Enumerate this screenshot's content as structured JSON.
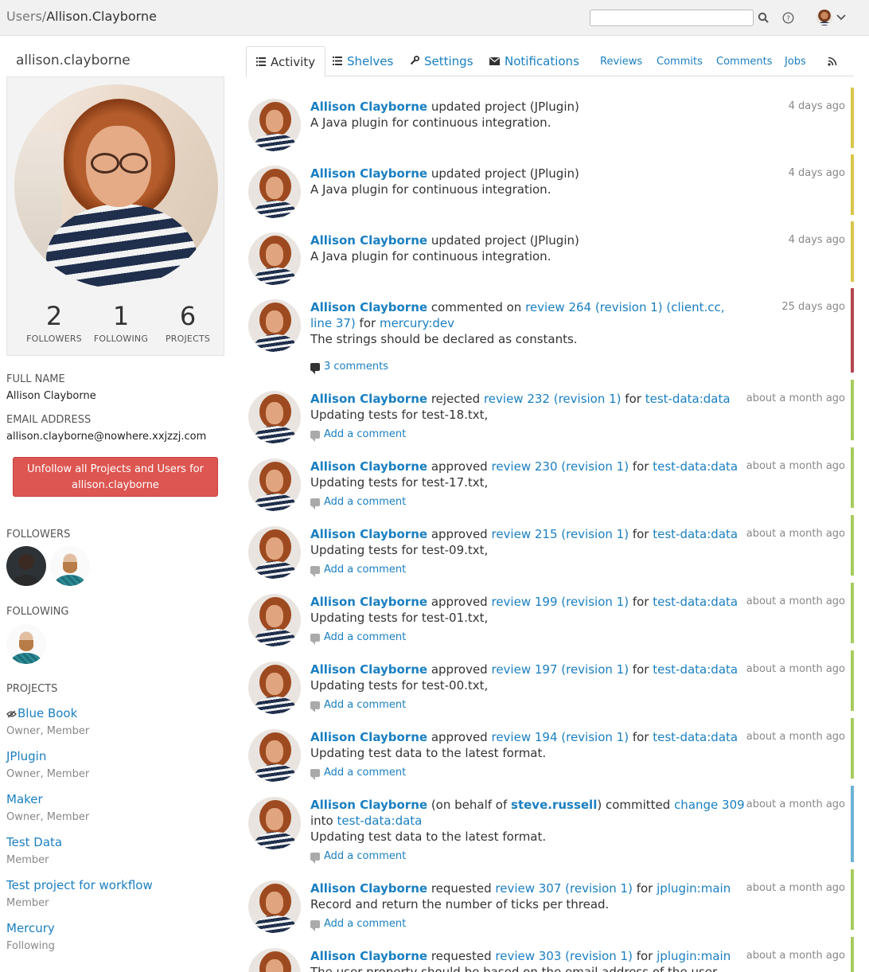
{
  "breadcrumb": {
    "root": "Users/",
    "current": "Allison.Clayborne"
  },
  "search": {
    "placeholder": ""
  },
  "profile": {
    "username": "allison.clayborne",
    "stats": [
      {
        "value": "2",
        "label": "FOLLOWERS"
      },
      {
        "value": "1",
        "label": "FOLLOWING"
      },
      {
        "value": "6",
        "label": "PROJECTS"
      }
    ],
    "full_name_label": "FULL NAME",
    "full_name": "Allison Clayborne",
    "email_label": "EMAIL ADDRESS",
    "email": "allison.clayborne@nowhere.xxjzzj.com",
    "unfollow_line1": "Unfollow all Projects and Users for",
    "unfollow_line2": "allison.clayborne",
    "followers_label": "FOLLOWERS",
    "following_label": "FOLLOWING",
    "projects_label": "PROJECTS",
    "projects": [
      {
        "name": "Blue Book",
        "role": "Owner, Member"
      },
      {
        "name": "JPlugin",
        "role": "Owner, Member"
      },
      {
        "name": "Maker",
        "role": "Owner, Member"
      },
      {
        "name": "Test Data",
        "role": "Member"
      },
      {
        "name": "Test project for workflow",
        "role": "Member"
      },
      {
        "name": "Mercury",
        "role": "Following"
      }
    ]
  },
  "tabs": {
    "activity": "Activity",
    "shelves": "Shelves",
    "settings": "Settings",
    "notifications": "Notifications",
    "reviews": "Reviews",
    "commits": "Commits",
    "comments": "Comments",
    "jobs": "Jobs"
  },
  "colors": {
    "link": "#1a7fc1",
    "yellow": "#d8c64a",
    "red": "#b5454f",
    "green": "#a6cc5e",
    "blue": "#6db3d6",
    "unfollow": "#dd5651"
  },
  "feed": [
    {
      "actor": "Allison Clayborne",
      "verb": " updated project (JPlugin)",
      "desc": "A Java plugin for continuous integration.",
      "time": "4 days ago"
    },
    {
      "actor": "Allison Clayborne",
      "verb": " updated project (JPlugin)",
      "desc": "A Java plugin for continuous integration.",
      "time": "4 days ago"
    },
    {
      "actor": "Allison Clayborne",
      "verb": " updated project (JPlugin)",
      "desc": "A Java plugin for continuous integration.",
      "time": "4 days ago"
    },
    {
      "actor": "Allison Clayborne",
      "verb": " commented on ",
      "link": "review 264 (revision 1) (client.cc, line 37)",
      "for": " for ",
      "target": "mercury:dev",
      "desc": "The strings should be declared as constants.",
      "time": "25 days ago",
      "comment": "3 comments"
    },
    {
      "actor": "Allison Clayborne",
      "verb": " rejected ",
      "link": "review 232 (revision 1)",
      "for": " for ",
      "target": "test-data:data",
      "desc": "Updating tests for test-18.txt,",
      "time": "about a month ago",
      "comment": "Add a comment"
    },
    {
      "actor": "Allison Clayborne",
      "verb": " approved ",
      "link": "review 230 (revision 1)",
      "for": " for ",
      "target": "test-data:data",
      "desc": "Updating tests for test-17.txt,",
      "time": "about a month ago",
      "comment": "Add a comment"
    },
    {
      "actor": "Allison Clayborne",
      "verb": " approved ",
      "link": "review 215 (revision 1)",
      "for": " for ",
      "target": "test-data:data",
      "desc": "Updating tests for test-09.txt,",
      "time": "about a month ago",
      "comment": "Add a comment"
    },
    {
      "actor": "Allison Clayborne",
      "verb": " approved ",
      "link": "review 199 (revision 1)",
      "for": " for ",
      "target": "test-data:data",
      "desc": "Updating tests for test-01.txt,",
      "time": "about a month ago",
      "comment": "Add a comment"
    },
    {
      "actor": "Allison Clayborne",
      "verb": " approved ",
      "link": "review 197 (revision 1)",
      "for": " for ",
      "target": "test-data:data",
      "desc": "Updating tests for test-00.txt,",
      "time": "about a month ago",
      "comment": "Add a comment"
    },
    {
      "actor": "Allison Clayborne",
      "verb": " approved ",
      "link": "review 194 (revision 1)",
      "for": " for ",
      "target": "test-data:data",
      "desc": "Updating test data to the latest format.",
      "time": "about a month ago",
      "comment": "Add a comment"
    },
    {
      "actor": "Allison Clayborne",
      "pre": " (on behalf of ",
      "behalf": "steve.russell",
      "verb": ") committed ",
      "link": "change 309",
      "for": " into ",
      "target": "test-data:data",
      "desc": "Updating test data to the latest format.",
      "time": "about a month ago",
      "comment": "Add a comment"
    },
    {
      "actor": "Allison Clayborne",
      "verb": " requested ",
      "link": "review 307 (revision 1)",
      "for": " for ",
      "target": "jplugin:main",
      "desc": "Record and return the number of ticks per thread.",
      "time": "about a month ago",
      "comment": "Add a comment"
    },
    {
      "actor": "Allison Clayborne",
      "verb": " requested ",
      "link": "review 303 (revision 1)",
      "for": " for ",
      "target": "jplugin:main",
      "desc": "The user property should be based on the email address of the user.",
      "time": "about a month ago"
    }
  ]
}
